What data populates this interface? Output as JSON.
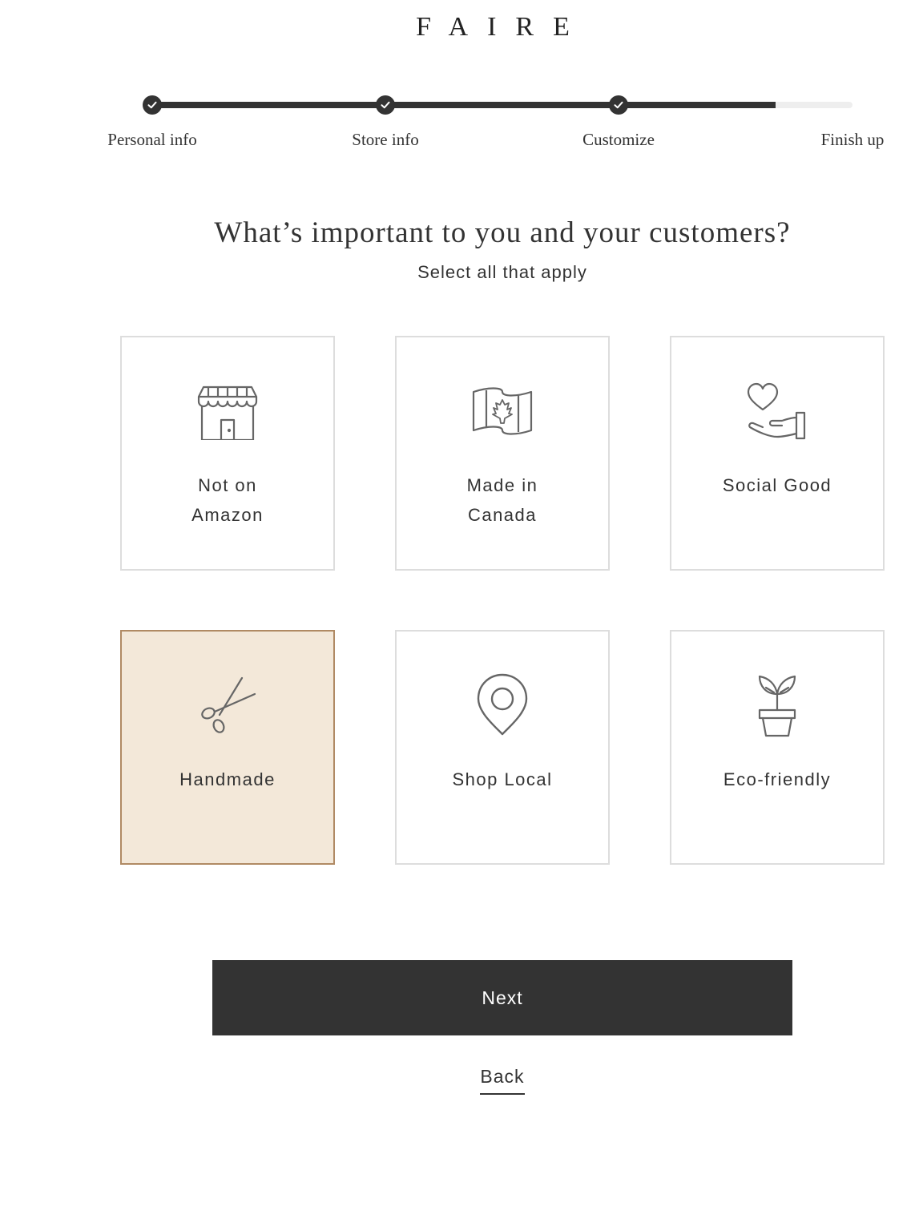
{
  "brand": {
    "logo": "FAIRE"
  },
  "progress": {
    "completed_fraction": 0.89,
    "steps": [
      {
        "label": "Personal info",
        "completed": true
      },
      {
        "label": "Store info",
        "completed": true
      },
      {
        "label": "Customize",
        "completed": true
      },
      {
        "label": "Finish up",
        "completed": false
      }
    ]
  },
  "page": {
    "title": "What’s important to you and your customers?",
    "subtitle": "Select all that apply"
  },
  "options": [
    {
      "line1": "Not on",
      "line2": "Amazon",
      "icon": "storefront-icon",
      "selected": false
    },
    {
      "line1": "Made in",
      "line2": "Canada",
      "icon": "canada-flag-icon",
      "selected": false
    },
    {
      "line1": "Social Good",
      "line2": "",
      "icon": "heart-hand-icon",
      "selected": false
    },
    {
      "line1": "Handmade",
      "line2": "",
      "icon": "scissors-icon",
      "selected": true
    },
    {
      "line1": "Shop Local",
      "line2": "",
      "icon": "map-pin-icon",
      "selected": false
    },
    {
      "line1": "Eco-friendly",
      "line2": "",
      "icon": "plant-icon",
      "selected": false
    }
  ],
  "actions": {
    "next_label": "Next",
    "back_label": "Back"
  },
  "colors": {
    "primary_dark": "#333333",
    "selected_bg": "#f3e8d9",
    "selected_border": "#b08a64",
    "card_border": "#dddddd",
    "icon_stroke": "#666666"
  }
}
